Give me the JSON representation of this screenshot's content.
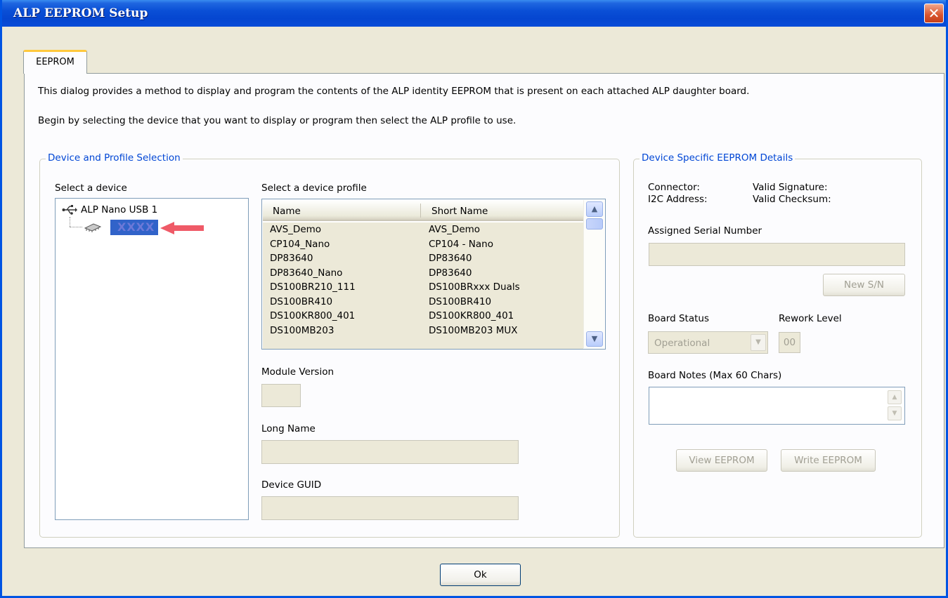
{
  "window": {
    "title": "ALP EEPROM Setup",
    "close_label": "✕"
  },
  "tabs": [
    {
      "label": "EEPROM"
    }
  ],
  "intro": {
    "line1": "This dialog provides a method to display and program the contents of the ALP identity EEPROM that is present on each attached ALP daughter board.",
    "line2": "Begin by selecting the device that you want to display or program then select the ALP profile to use."
  },
  "selection": {
    "group_title": "Device and Profile Selection",
    "device_label": "Select a device",
    "tree": {
      "root": "ALP Nano USB 1",
      "child": "XXXX"
    },
    "profile_label": "Select a device profile",
    "columns": [
      "Name",
      "Short Name"
    ],
    "profiles": [
      {
        "name": "AVS_Demo",
        "short": "AVS_Demo"
      },
      {
        "name": "CP104_Nano",
        "short": "CP104 - Nano"
      },
      {
        "name": "DP83640",
        "short": "DP83640"
      },
      {
        "name": "DP83640_Nano",
        "short": "DP83640"
      },
      {
        "name": "DS100BR210_111",
        "short": "DS100BRxxx Duals"
      },
      {
        "name": "DS100BR410",
        "short": "DS100BR410"
      },
      {
        "name": "DS100KR800_401",
        "short": "DS100KR800_401"
      },
      {
        "name": "DS100MB203",
        "short": "DS100MB203 MUX"
      }
    ],
    "module_version_label": "Module Version",
    "module_version_value": "",
    "long_name_label": "Long Name",
    "long_name_value": "",
    "device_guid_label": "Device GUID",
    "device_guid_value": ""
  },
  "details": {
    "group_title": "Device Specific EEPROM Details",
    "connector_label": "Connector:",
    "i2c_label": "I2C Address:",
    "valid_signature_label": "Valid Signature:",
    "valid_checksum_label": "Valid Checksum:",
    "serial_label": "Assigned Serial Number",
    "serial_value": "",
    "new_sn_button": "New S/N",
    "board_status_label": "Board Status",
    "board_status_value": "Operational",
    "rework_label": "Rework Level",
    "rework_value": "00",
    "notes_label": "Board Notes (Max 60 Chars)",
    "notes_value": "",
    "view_button": "View EEPROM",
    "write_button": "Write EEPROM"
  },
  "footer": {
    "ok_button": "Ok"
  },
  "colors": {
    "titlebar": "#0a4fd6",
    "tab_accent": "#ffc83c",
    "group_title": "#0046d5",
    "selection": "#3163c9",
    "selection_text": "#6d79d8",
    "arrow": "#ef5a67"
  },
  "icons": {
    "usb": "usb-icon",
    "chip": "chip-icon",
    "arrow": "red-arrow-icon"
  }
}
